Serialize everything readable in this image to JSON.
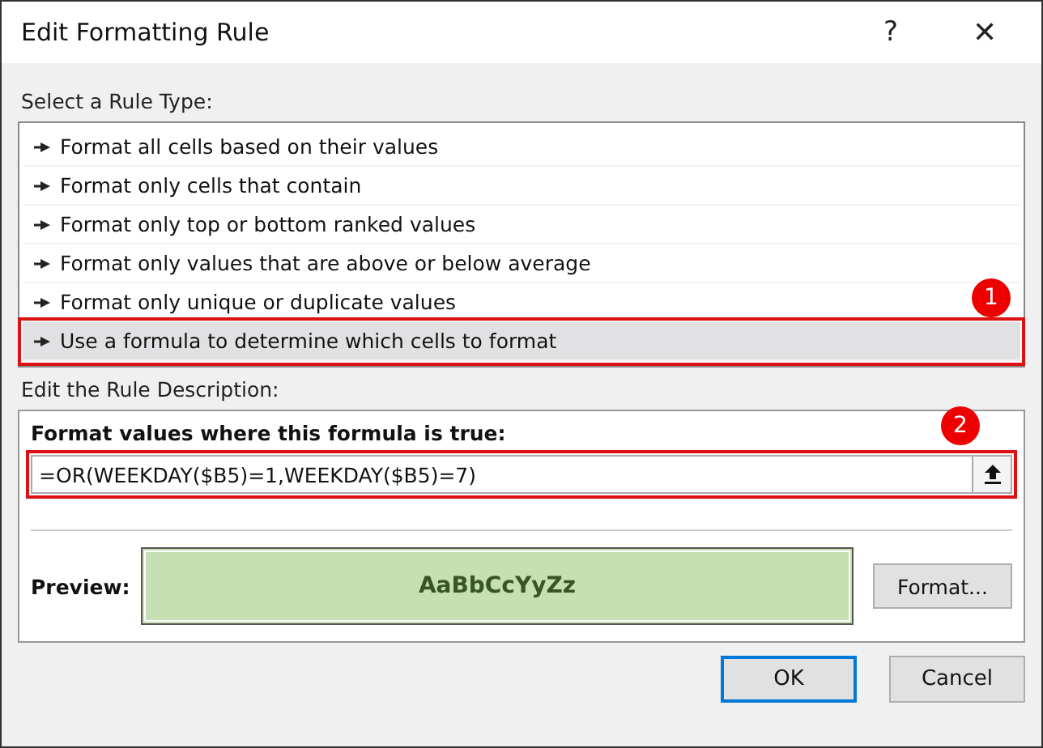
{
  "window": {
    "title": "Edit Formatting Rule",
    "help": "?",
    "close": "✕"
  },
  "rule_type": {
    "label": "Select a Rule Type:",
    "items": [
      {
        "label": "Format all cells based on their values",
        "selected": false
      },
      {
        "label": "Format only cells that contain",
        "selected": false
      },
      {
        "label": "Format only top or bottom ranked values",
        "selected": false
      },
      {
        "label": "Format only values that are above or below average",
        "selected": false
      },
      {
        "label": "Format only unique or duplicate values",
        "selected": false
      },
      {
        "label": "Use a formula to determine which cells to format",
        "selected": true,
        "callout": "1"
      }
    ]
  },
  "description": {
    "label": "Edit the Rule Description:",
    "formula_label": "Format values where this formula is true:",
    "formula": {
      "value": "=OR(WEEKDAY($B5)=1,WEEKDAY($B5)=7)",
      "callout": "2"
    },
    "preview_label": "Preview:",
    "preview_text": "AaBbCcYyZz",
    "format_button": "Format..."
  },
  "buttons": [
    "OK",
    "Cancel"
  ]
}
